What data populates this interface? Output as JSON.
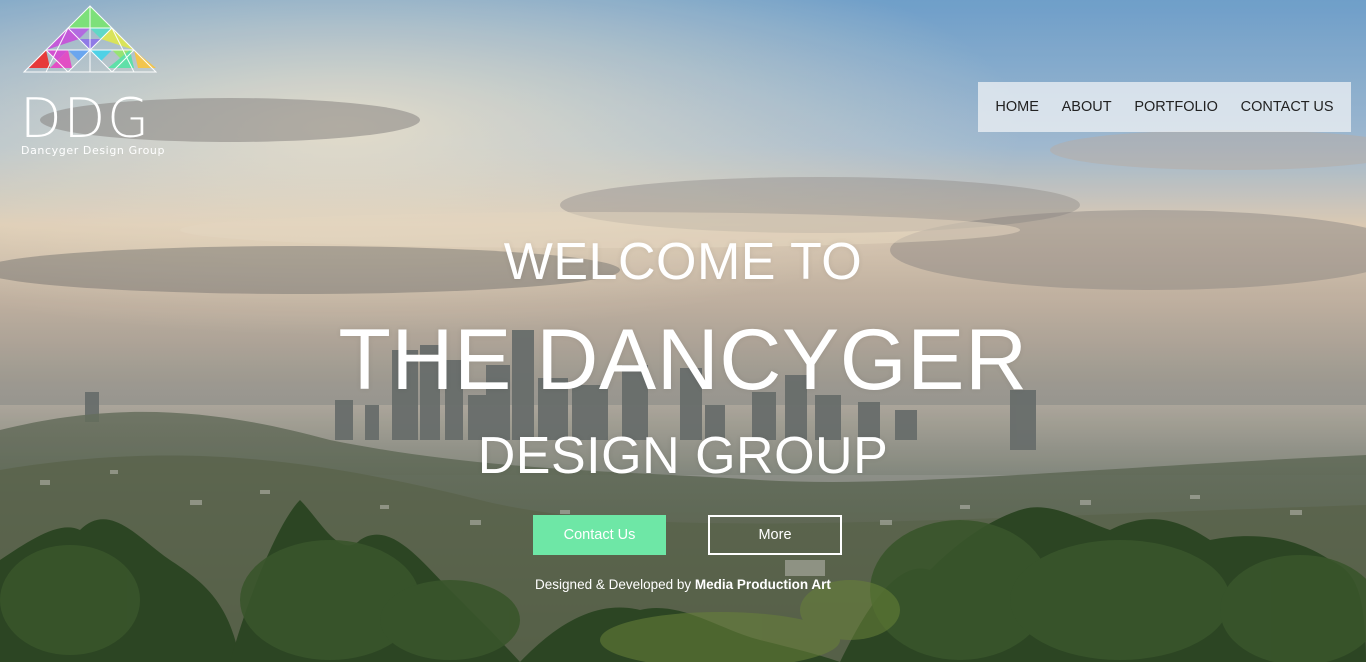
{
  "brand": {
    "logo_text": "DDG",
    "logo_subtitle": "Dancyger Design Group"
  },
  "nav": {
    "items": [
      {
        "label": "HOME"
      },
      {
        "label": "ABOUT"
      },
      {
        "label": "PORTFOLIO"
      },
      {
        "label": "CONTACT US"
      }
    ]
  },
  "hero": {
    "line1": "WELCOME TO",
    "line2": "THE DANCYGER",
    "line3": "DESIGN GROUP",
    "contact_button": "Contact Us",
    "more_button": "More",
    "credit_prefix": "Designed & Developed by",
    "credit_name": "Media Production Art"
  },
  "colors": {
    "contact_button": "#6ee7a6",
    "nav_background": "#ecf0f4",
    "text": "#ffffff"
  }
}
